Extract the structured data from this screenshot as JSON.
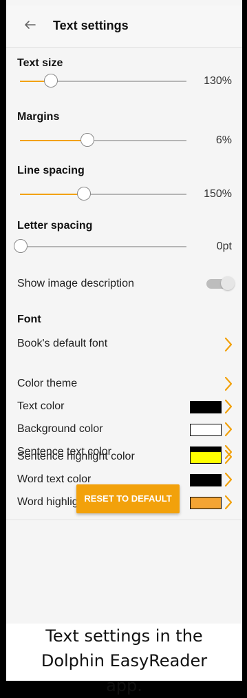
{
  "header": {
    "title": "Text settings"
  },
  "sliders": [
    {
      "label": "Text size",
      "value_text": "130%",
      "fraction": 0.18
    },
    {
      "label": "Margins",
      "value_text": "6%",
      "fraction": 0.4
    },
    {
      "label": "Line spacing",
      "value_text": "150%",
      "fraction": 0.38
    },
    {
      "label": "Letter spacing",
      "value_text": "0pt",
      "fraction": 0.0
    }
  ],
  "toggle": {
    "label": "Show image description",
    "state": "off"
  },
  "font": {
    "title": "Font",
    "value": "Book's default font"
  },
  "colors": {
    "theme_label": "Color theme",
    "items": [
      {
        "label": "Text color",
        "swatch": "#000000"
      },
      {
        "label": "Background color",
        "swatch": "#ffffff"
      },
      {
        "label": "Sentence text color",
        "swatch": "#000000"
      },
      {
        "label": "Sentence highlight color",
        "swatch": "#ffff00"
      },
      {
        "label": "Word text color",
        "swatch": "#000000"
      },
      {
        "label": "Word highlight color",
        "swatch": "#f4a433"
      }
    ]
  },
  "actions": {
    "reset_label": "RESET TO DEFAULT"
  },
  "caption": {
    "line1": "Text settings in the",
    "line2": "Dolphin EasyReader",
    "line3": "app."
  },
  "accent": "#f2a10b"
}
